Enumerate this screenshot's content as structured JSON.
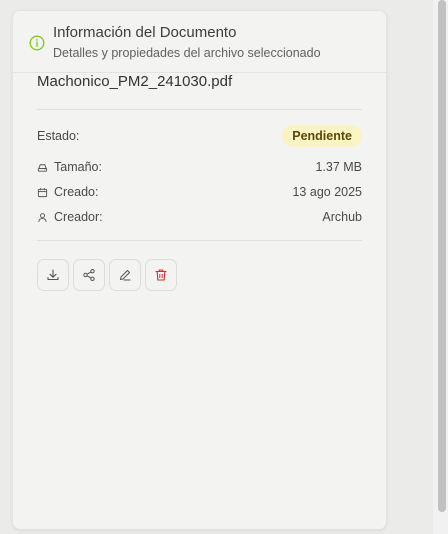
{
  "header": {
    "title": "Información del Documento",
    "subtitle": "Detalles y propiedades del archivo seleccionado",
    "icon": "info-icon"
  },
  "document": {
    "filename": "Machonico_PM2_241030.pdf"
  },
  "status": {
    "label": "Estado:",
    "value": "Pendiente",
    "badge_bg": "#fbf3c4",
    "badge_fg": "#584a06"
  },
  "properties": [
    {
      "icon": "drive-icon",
      "label": "Tamaño:",
      "value": "1.37 MB"
    },
    {
      "icon": "calendar-icon",
      "label": "Creado:",
      "value": "13 ago 2025"
    },
    {
      "icon": "user-icon",
      "label": "Creador:",
      "value": "Archub"
    }
  ],
  "actions": [
    {
      "name": "download",
      "icon": "download-icon"
    },
    {
      "name": "share",
      "icon": "share-icon"
    },
    {
      "name": "edit",
      "icon": "edit-icon"
    },
    {
      "name": "delete",
      "icon": "trash-icon",
      "color": "#d32f2f"
    }
  ],
  "colors": {
    "accent_info": "#84cc16",
    "danger": "#d32f2f"
  }
}
